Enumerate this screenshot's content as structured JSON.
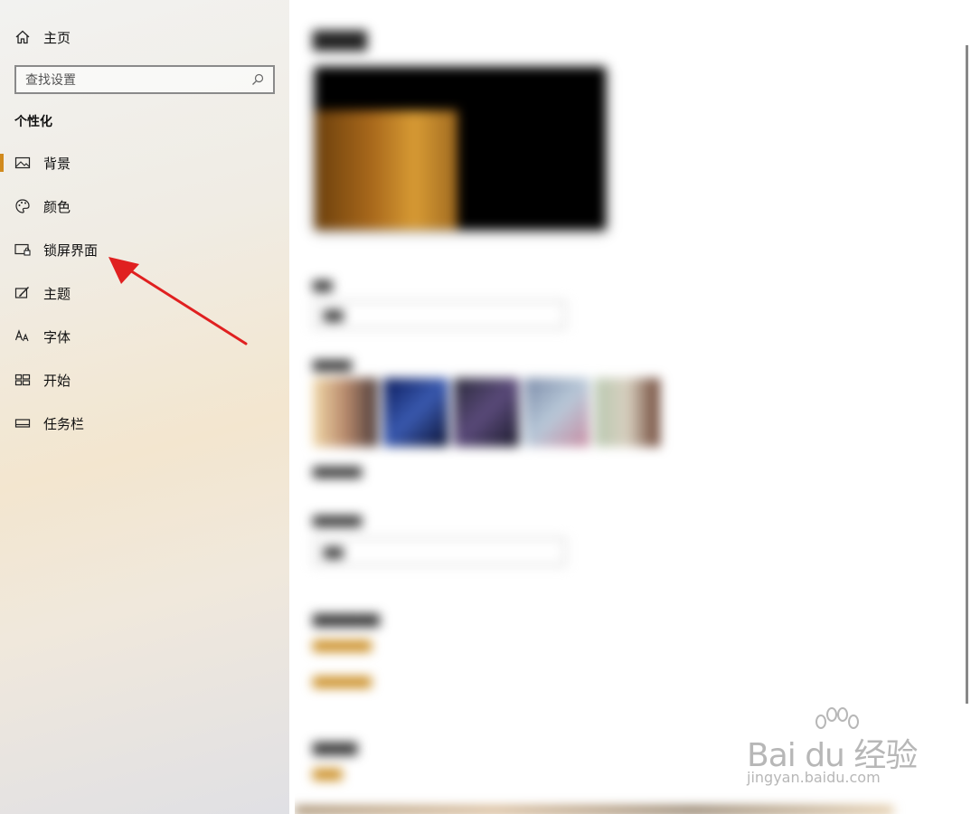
{
  "sidebar": {
    "home_label": "主页",
    "search_placeholder": "查找设置",
    "section_title": "个性化",
    "items": [
      {
        "label": "背景",
        "icon": "image-icon",
        "active": true
      },
      {
        "label": "颜色",
        "icon": "palette-icon",
        "active": false
      },
      {
        "label": "锁屏界面",
        "icon": "lock-screen-icon",
        "active": false
      },
      {
        "label": "主题",
        "icon": "theme-brush-icon",
        "active": false
      },
      {
        "label": "字体",
        "icon": "font-icon",
        "active": false
      },
      {
        "label": "开始",
        "icon": "start-tiles-icon",
        "active": false
      },
      {
        "label": "任务栏",
        "icon": "taskbar-icon",
        "active": false
      }
    ]
  },
  "main": {
    "blurred": true
  },
  "watermark": {
    "logo": "Bai du 经验",
    "url": "jingyan.baidu.com"
  },
  "colors": {
    "accent": "#d18a1e",
    "annotation_arrow": "#e02020"
  }
}
